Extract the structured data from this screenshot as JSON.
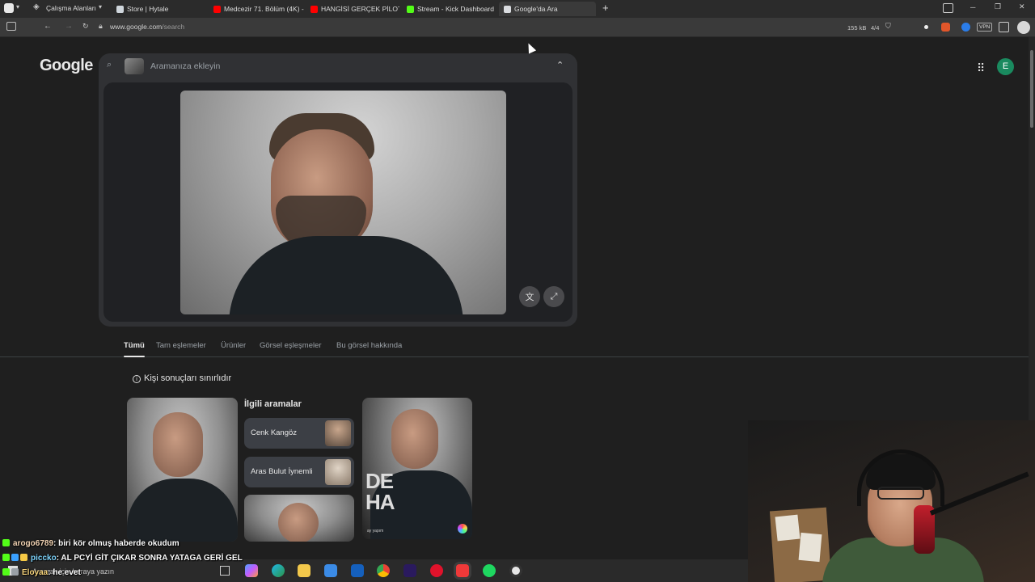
{
  "browser": {
    "workspace_label": "Çalışma Alanları",
    "tabs": [
      {
        "label": "Store | Hytale",
        "color": "#cfd6dc"
      },
      {
        "label": "Medcezir 71. Bölüm (4K) - ",
        "color": "#ff0000"
      },
      {
        "label": "HANGİSİ GERÇEK PİLOT?! ",
        "color": "#ff0000"
      },
      {
        "label": "Stream - Kick Dashboard",
        "color": "#53fc18"
      },
      {
        "label": "Google'da Ara",
        "color": "#dadce0"
      }
    ],
    "new_tab": "+",
    "url_host": "www.google.com",
    "url_path": "/search",
    "stats": {
      "size": "155 kB",
      "count": "4/4"
    },
    "vpn": "VPN",
    "window_controls": {
      "minimize": "─",
      "restore": "❐",
      "close": "✕"
    }
  },
  "google": {
    "logo": "Google",
    "search_placeholder": "Aramanıza ekleyin",
    "avatar_letter": "E",
    "accent": "#1a8a5f",
    "result_tabs": [
      "Tümü",
      "Tam eşlemeler",
      "Ürünler",
      "Görsel eşleşmeler",
      "Bu görsel hakkında"
    ],
    "notice": "Kişi sonuçları sınırlıdır",
    "related_title": "İlgili aramalar",
    "related_searches": [
      "Cenk Kangöz",
      "Aras Bulut İynemli"
    ],
    "poster_text": "DEHA",
    "poster_sub": "ay yapım"
  },
  "chat": [
    {
      "user": "arogo6789",
      "text": ": biri kör olmuş haberde okudum",
      "color": "#f3d4b4"
    },
    {
      "user": "piccko",
      "text": ": AL PCYİ GİT ÇIKAR SONRA YATAGA GERİ GEL",
      "color": "#7fd6ff"
    },
    {
      "user": "Eloyaa",
      "text": ": he evet",
      "color": "#f6d37a"
    }
  ],
  "taskbar": {
    "search_placeholder": "Aramak için buraya yazın"
  }
}
